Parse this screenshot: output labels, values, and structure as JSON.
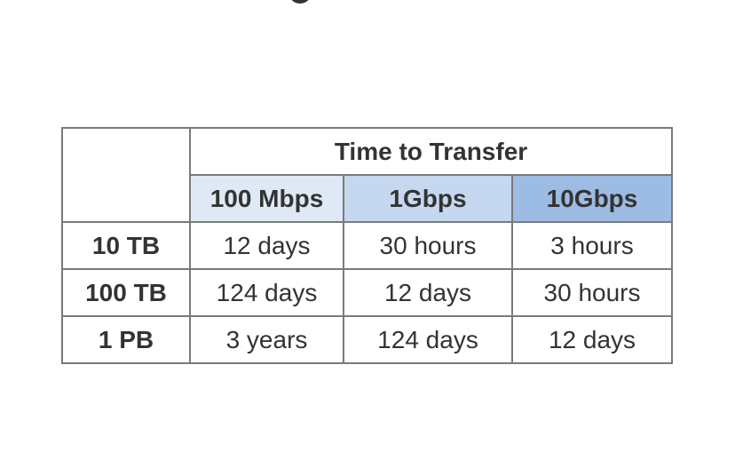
{
  "table": {
    "title": "Time to Transfer",
    "columns": [
      "100 Mbps",
      "1Gbps",
      "10Gbps"
    ],
    "rows": [
      {
        "label": "10 TB",
        "values": [
          "12 days",
          "30 hours",
          "3 hours"
        ]
      },
      {
        "label": "100 TB",
        "values": [
          "124 days",
          "12 days",
          "30 hours"
        ]
      },
      {
        "label": "1 PB",
        "values": [
          "3 years",
          "124 days",
          "12 days"
        ]
      }
    ]
  },
  "colors": {
    "text": "#333333",
    "border": "#7a7a7a",
    "header_light": "#dfe9f6",
    "header_mid": "#c5d8ef",
    "header_dark": "#9dbce3"
  }
}
